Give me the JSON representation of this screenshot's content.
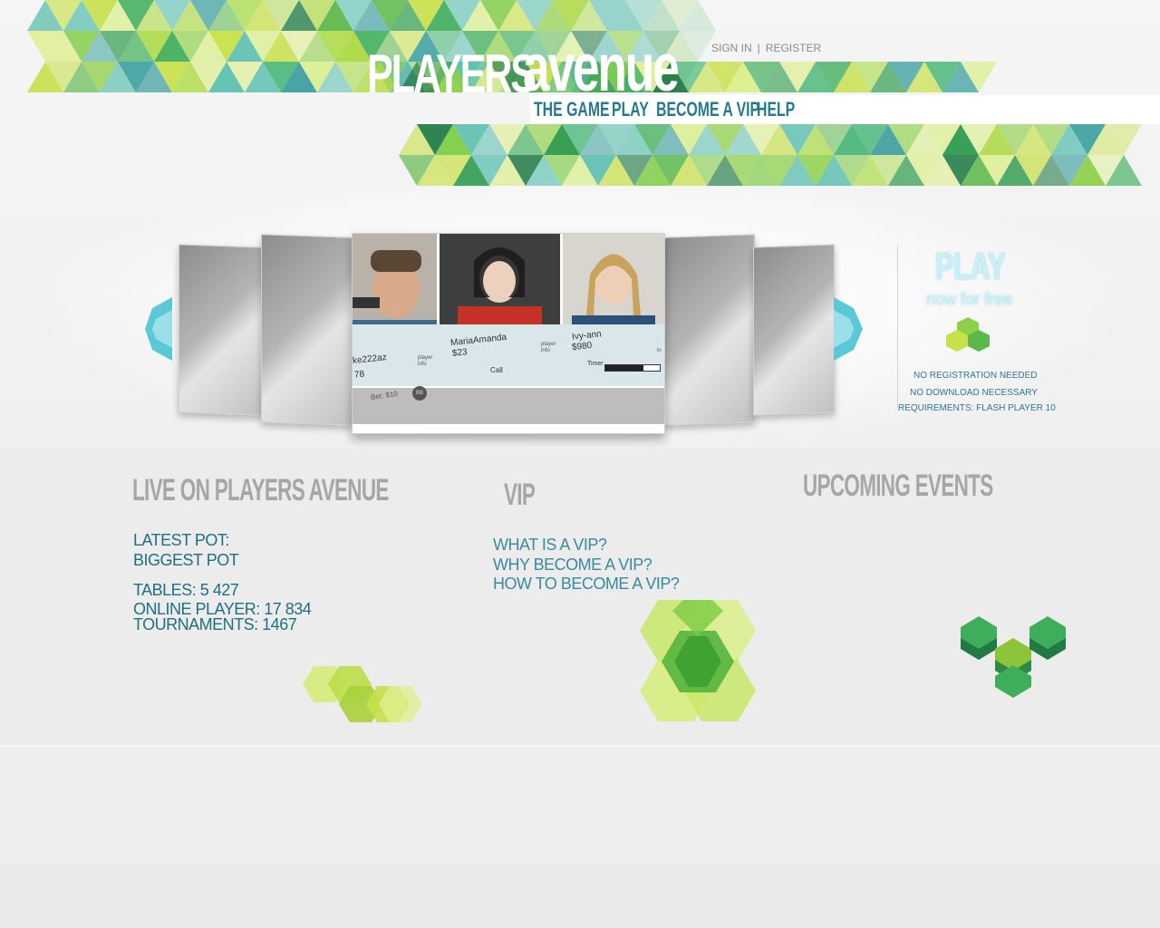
{
  "brand": {
    "part1": "PLAYERS",
    "part2": "avenue"
  },
  "auth": {
    "sign_in": "SIGN IN",
    "separator": "|",
    "register": "REGISTER"
  },
  "nav": {
    "items": [
      "THE GAME",
      "PLAY",
      "BECOME A VIP",
      "HELP"
    ]
  },
  "carousel": {
    "players": [
      {
        "name": "ke222az",
        "money": "78",
        "info": "player info"
      },
      {
        "name": "MariaAmanda",
        "money": "$23",
        "info": "player info"
      },
      {
        "name": "Ivy-ann",
        "money": "$980",
        "info": "in"
      }
    ],
    "call": "Call",
    "timer": "Timer",
    "timer_progress": 0.7,
    "bet": "Bet: $10",
    "chip": "BB"
  },
  "promo": {
    "title": "PLAY",
    "subtitle": "now for free",
    "notes": [
      "NO REGISTRATION NEEDED",
      "NO DOWNLOAD NECESSARY",
      "REQUIREMENTS: FLASH PLAYER 10"
    ]
  },
  "live": {
    "title": "LIVE ON PLAYERS AVENUE",
    "latest_pot": "LATEST POT:",
    "biggest_pot": "BIGGEST POT",
    "tables": "TABLES: 5 427",
    "online": "ONLINE PLAYER: 17 834",
    "tournaments": "TOURNAMENTS: 1467"
  },
  "vip": {
    "title": "VIP",
    "links": [
      "WHAT IS A VIP?",
      "WHY BECOME A VIP?",
      "HOW TO BECOME A VIP?"
    ]
  },
  "events": {
    "title": "UPCOMING EVENTS"
  },
  "colors": {
    "teal": "#2a7a8c",
    "green": "#7cc242",
    "lime": "#c8e04a",
    "gray_title": "#a6a6a6"
  }
}
